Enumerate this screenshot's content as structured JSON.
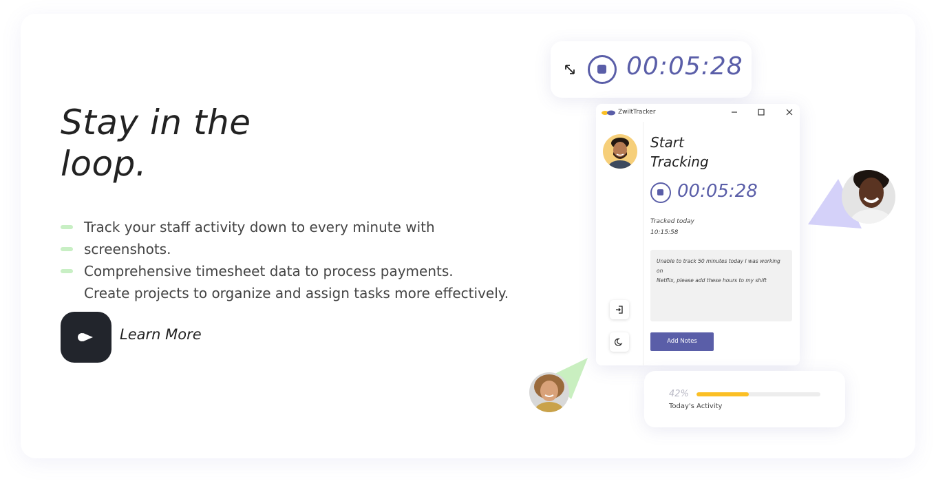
{
  "hero": {
    "title_line1": "Stay in the",
    "title_line2": "loop.",
    "bullets": [
      "Track your staff activity down to every minute with",
      "screenshots.",
      "Comprehensive timesheet data to process payments."
    ],
    "extra_line": "Create projects to organize and assign tasks more effectively.",
    "learn_more_label": "Learn More"
  },
  "timer_widget": {
    "time": "00:05:28"
  },
  "app_window": {
    "brand": "ZwiltTracker",
    "heading_line1": "Start",
    "heading_line2": "Tracking",
    "time": "00:05:28",
    "tracked_label": "Tracked today",
    "tracked_value": "10:15:58",
    "note_line1": "Unable to track 50 minutes today I was working on",
    "note_line2": "Netflix, please add these hours to my shift",
    "add_notes_label": "Add Notes"
  },
  "activity": {
    "percent_text": "42%",
    "percent_value": 0.42,
    "label": "Today's Activity"
  },
  "colors": {
    "accent": "#5a5ea8",
    "dark_button": "#22252c",
    "progress": "#fbbf24",
    "bullet_dash": "#c8efc4",
    "triangle_purple": "#d4d1f9",
    "triangle_green": "#c9efc0"
  },
  "icons": {
    "expand": "expand-arrows-icon",
    "stop": "stop-circle-icon",
    "logout": "logout-icon",
    "theme": "moon-icon",
    "play": "play-arrow-icon"
  }
}
